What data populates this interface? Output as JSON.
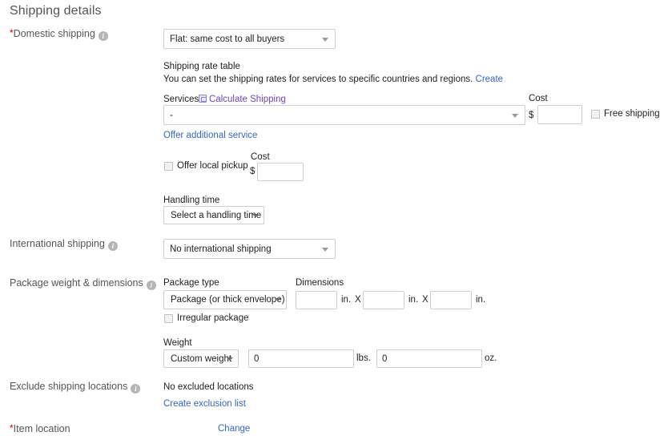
{
  "page": {
    "title": "Shipping details"
  },
  "colors": {
    "link": "#3665c3",
    "visited_link": "#6b46c1",
    "label": "#555555",
    "required_asterisk": "#cc0000"
  },
  "domestic_shipping": {
    "label": "Domestic shipping",
    "required_marker": "*",
    "info_icon": "info-icon",
    "select_value": "Flat: same cost to all buyers",
    "rate_table": {
      "heading": "Shipping rate table",
      "description": "You can set the shipping rates for services to specific countries and regions.",
      "create_link": "Create"
    },
    "services": {
      "label": "Services",
      "calculate_shipping_link": "Calculate Shipping",
      "calculate_icon": "calculator-icon",
      "select_value": "-",
      "offer_additional_service_link": "Offer additional service"
    },
    "cost": {
      "label": "Cost",
      "currency_symbol": "$",
      "value": "",
      "placeholder": ""
    },
    "free_shipping": {
      "label": "Free shipping",
      "checked": false
    },
    "local_pickup": {
      "label": "Offer local pickup",
      "checked": false,
      "cost_label": "Cost",
      "currency_symbol": "$",
      "cost_value": "",
      "cost_placeholder": ""
    },
    "handling_time": {
      "label": "Handling time",
      "select_value": "Select a handling time"
    }
  },
  "international_shipping": {
    "label": "International shipping",
    "info_icon": "info-icon",
    "select_value": "No international shipping"
  },
  "package": {
    "label": "Package weight & dimensions",
    "info_icon": "info-icon",
    "package_type": {
      "label": "Package type",
      "select_value": "Package (or thick envelope)"
    },
    "irregular_package": {
      "label": "Irregular package",
      "checked": false
    },
    "dimensions": {
      "label": "Dimensions",
      "length_value": "",
      "width_value": "",
      "height_value": "",
      "unit": "in.",
      "separator": "X"
    },
    "weight": {
      "label": "Weight",
      "select_value": "Custom weight",
      "lbs_value": "0",
      "lbs_unit": "lbs.",
      "oz_value": "0",
      "oz_unit": "oz."
    }
  },
  "exclude_locations": {
    "label": "Exclude shipping locations",
    "info_icon": "info-icon",
    "status_text": "No excluded locations",
    "create_exclusion_link": "Create exclusion list"
  },
  "item_location": {
    "label": "Item location",
    "required_marker": "*",
    "change_link": "Change"
  }
}
